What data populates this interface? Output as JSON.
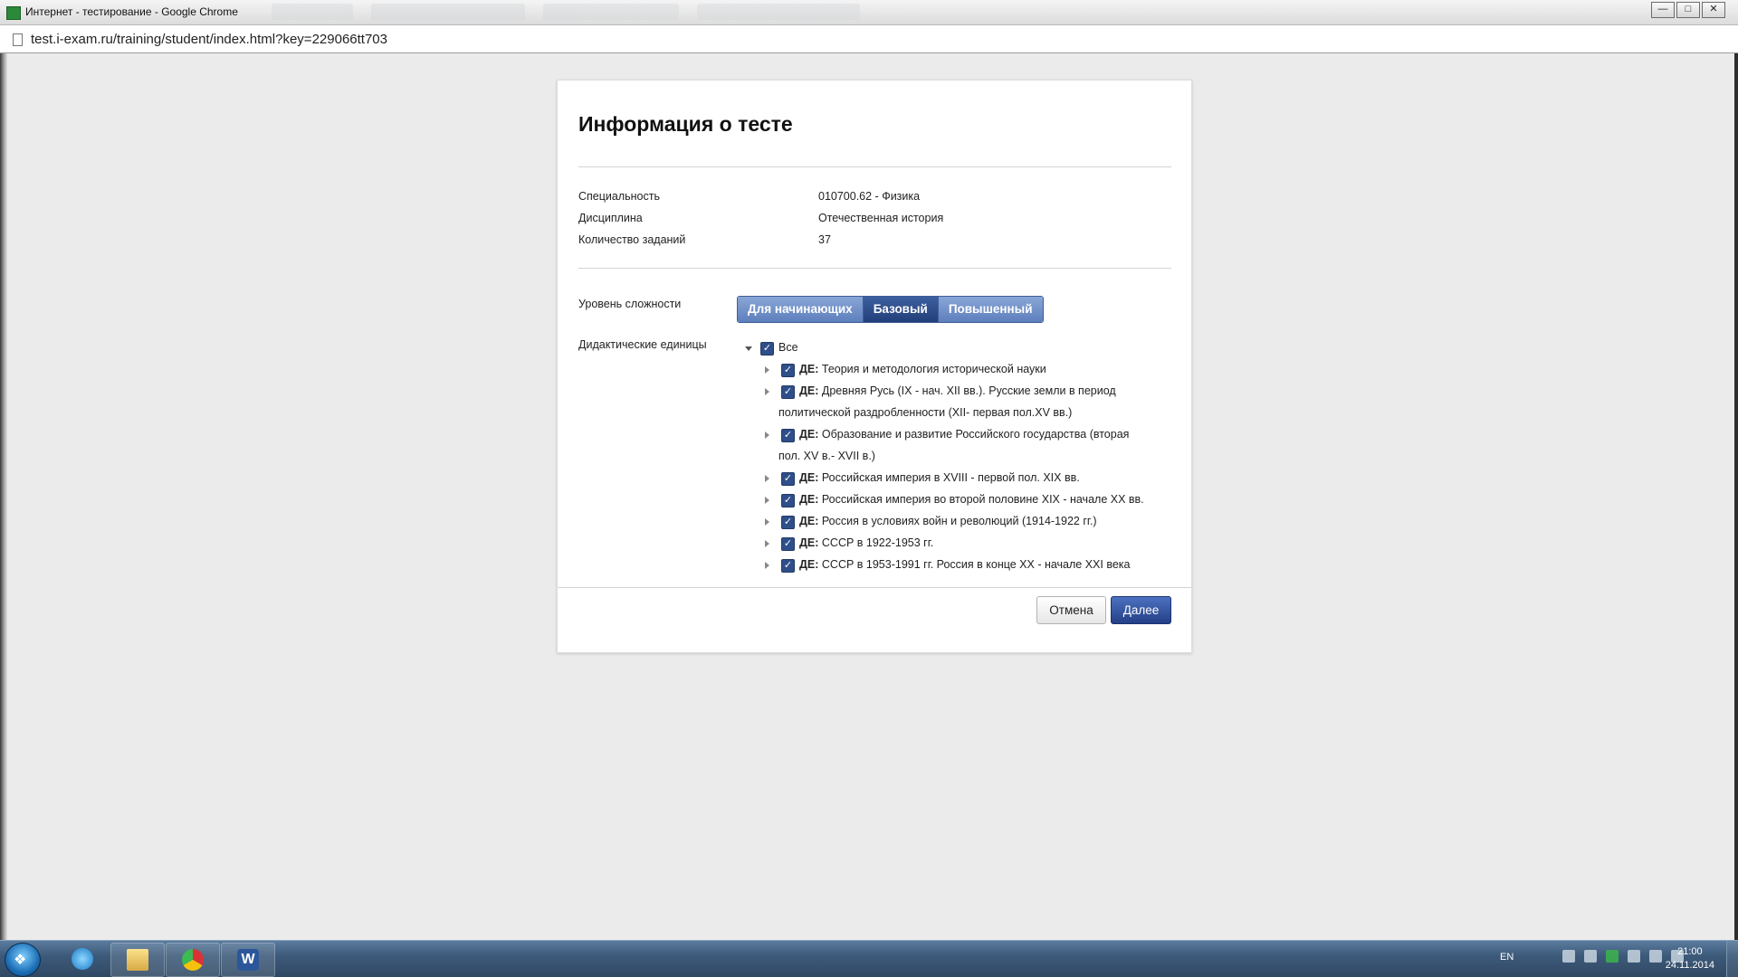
{
  "window": {
    "title": "Интернет - тестирование - Google Chrome",
    "url": "test.i-exam.ru/training/student/index.html?key=229066tt703",
    "controls": {
      "minimize": "—",
      "maximize": "□",
      "close": "✕"
    }
  },
  "dialog": {
    "title": "Информация о тесте",
    "info": [
      {
        "label": "Специальность",
        "value": "010700.62 - Физика"
      },
      {
        "label": "Дисциплина",
        "value": "Отечественная история"
      },
      {
        "label": "Количество заданий",
        "value": "37"
      }
    ],
    "difficulty_label": "Уровень сложности",
    "difficulty_levels": [
      {
        "label": "Для начинающих",
        "selected": false
      },
      {
        "label": "Базовый",
        "selected": true
      },
      {
        "label": "Повышенный",
        "selected": false
      }
    ],
    "units_label": "Дидактические единицы",
    "units_root": {
      "label": "Все",
      "checked": true
    },
    "units_prefix": "ДЕ:",
    "units": [
      {
        "line1": "Теория и методология исторической науки",
        "line2": "",
        "checked": true
      },
      {
        "line1": "Древняя Русь (IX - нач. XII вв.). Русские земли в период",
        "line2": "политической раздробленности (XII- первая пол.XV вв.)",
        "checked": true
      },
      {
        "line1": "Образование и развитие Российского государства (вторая",
        "line2": "пол. XV в.- XVII в.)",
        "checked": true
      },
      {
        "line1": "Российская империя в XVIII - первой пол. XIX вв.",
        "line2": "",
        "checked": true
      },
      {
        "line1": "Российская империя во второй половине XIX - начале XX вв.",
        "line2": "",
        "checked": true
      },
      {
        "line1": "Россия в условиях войн и революций (1914-1922 гг.)",
        "line2": "",
        "checked": true
      },
      {
        "line1": "СССР в 1922-1953 гг.",
        "line2": "",
        "checked": true
      },
      {
        "line1": "СССР в 1953-1991 гг. Россия в конце XX - начале XXI века",
        "line2": "",
        "checked": true
      }
    ],
    "cancel_label": "Отмена",
    "next_label": "Далее"
  },
  "taskbar": {
    "apps": [
      "internet-explorer",
      "windows-explorer",
      "google-chrome",
      "microsoft-word"
    ],
    "word_glyph": "W",
    "language": "EN",
    "time": "21:00",
    "date": "24.11.2014"
  }
}
